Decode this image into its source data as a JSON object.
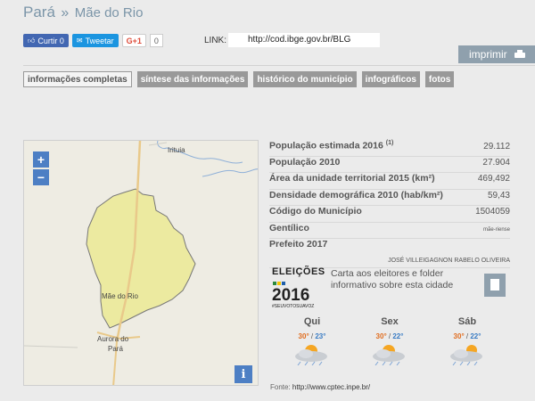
{
  "breadcrumb": {
    "state": "Pará",
    "separator": "»",
    "city": "Mãe do Rio"
  },
  "social": {
    "facebook": "Curtir 0",
    "twitter": "Tweetar",
    "gplus": "G+1",
    "gplus_count": "0"
  },
  "link": {
    "label": "LINK:",
    "url": "http://cod.ibge.gov.br/BLG"
  },
  "print_button": "imprimir",
  "tabs": [
    {
      "label": "informações completas",
      "active": true
    },
    {
      "label": "síntese das informações",
      "active": false
    },
    {
      "label": "histórico do município",
      "active": false
    },
    {
      "label": "infográficos",
      "active": false
    },
    {
      "label": "fotos",
      "active": false
    }
  ],
  "map": {
    "zoom_in": "+",
    "zoom_out": "−",
    "info": "i",
    "labels": {
      "irituia": "Irituia",
      "mae_do_rio": "Mãe do Rio",
      "aurora": "Aurora do",
      "para": "Pará"
    }
  },
  "stats": [
    {
      "label": "População estimada 2016",
      "sup": "(1)",
      "value": "29.112"
    },
    {
      "label": "População 2010",
      "value": "27.904"
    },
    {
      "label": "Área da unidade territorial 2015 (km²)",
      "value": "469,492"
    },
    {
      "label": "Densidade demográfica 2010 (hab/km²)",
      "value": "59,43"
    },
    {
      "label": "Código do Município",
      "value": "1504059"
    },
    {
      "label": "Gentílico",
      "value": "mãe-riense"
    },
    {
      "label": "Prefeito 2017",
      "value": ""
    }
  ],
  "prefeito_name": "JOSÉ VILLEIGAGNON RABELO OLIVEIRA",
  "elections": {
    "logo_title": "ELEIÇÕES",
    "logo_year": "2016",
    "logo_hashtag": "#SEUVOTOSUAVOZ",
    "text": "Carta aos eleitores e folder informativo sobre esta cidade"
  },
  "weather": [
    {
      "day": "Qui",
      "max": "30°",
      "min": "23°"
    },
    {
      "day": "Sex",
      "max": "30°",
      "min": "22°"
    },
    {
      "day": "Sáb",
      "max": "30°",
      "min": "22°"
    }
  ],
  "source": {
    "label": "Fonte:",
    "url": "http://www.cptec.inpe.br/"
  },
  "colors": {
    "accent": "#4d7fc4",
    "municipality_fill": "#eceaa0",
    "tab_bg": "#999999",
    "print_bg": "#8fa0ad"
  }
}
